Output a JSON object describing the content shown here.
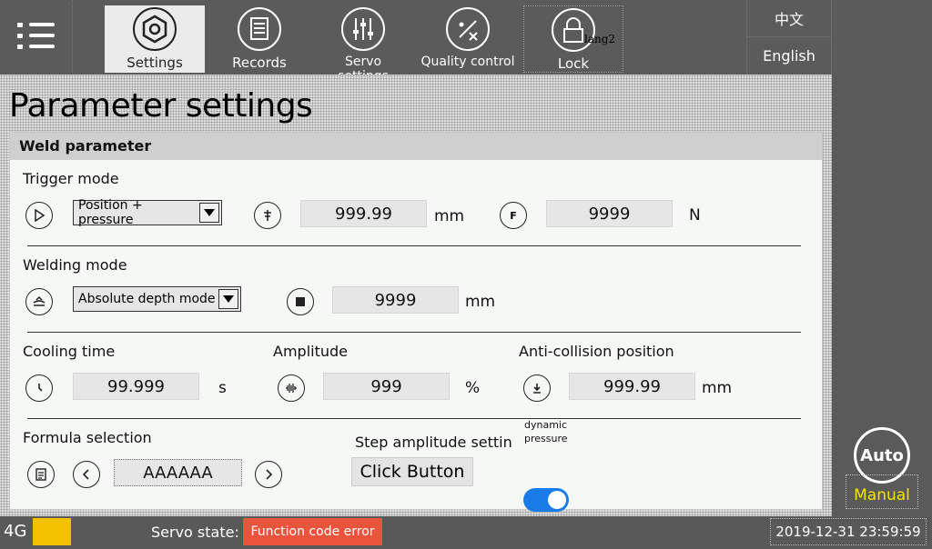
{
  "nav": {
    "tabs": [
      {
        "label": "Settings",
        "icon": "hex-nut-icon",
        "active": true
      },
      {
        "label": "Records",
        "icon": "document-icon"
      },
      {
        "label": "Servo settings",
        "icon": "sliders-icon"
      },
      {
        "label": "Quality control",
        "icon": "percent-icon"
      },
      {
        "label": "Lock",
        "icon": "lock-icon",
        "overlay": "lang2"
      }
    ],
    "languages": [
      "中文",
      "English"
    ]
  },
  "page": {
    "title": "Parameter settings"
  },
  "panel": {
    "title": "Weld parameter",
    "trigger": {
      "label": "Trigger mode",
      "select": "Position + pressure",
      "position_value": "999.99",
      "position_unit": "mm",
      "pressure_value": "9999",
      "pressure_unit": "N",
      "pressure_icon_text": "F"
    },
    "welding": {
      "label": "Welding mode",
      "select": "Absolute depth mode",
      "depth_value": "9999",
      "depth_unit": "mm"
    },
    "cooling": {
      "label": "Cooling time",
      "value": "99.999",
      "unit": "s"
    },
    "amplitude": {
      "label": "Amplitude",
      "value": "999",
      "unit": "%"
    },
    "anticollision": {
      "label": "Anti-collision position",
      "value": "999.99",
      "unit": "mm"
    },
    "formula": {
      "label": "Formula selection",
      "value": "AAAAAA"
    },
    "step": {
      "label": "Step amplitude setting",
      "button": "Click Button"
    },
    "dynamic": {
      "label": "dynamic pressure",
      "on": true
    }
  },
  "side": {
    "auto": "Auto",
    "manual": "Manual"
  },
  "status": {
    "network": "4G",
    "servo_label": "Servo state:",
    "servo_value": "Function code error",
    "datetime": "2019-12-31  23:59:59"
  },
  "colors": {
    "accent_blue": "#1a7ce8",
    "error_red": "#e9543d",
    "signal_yellow": "#f2c200",
    "manual_yellow": "#f5e400"
  }
}
